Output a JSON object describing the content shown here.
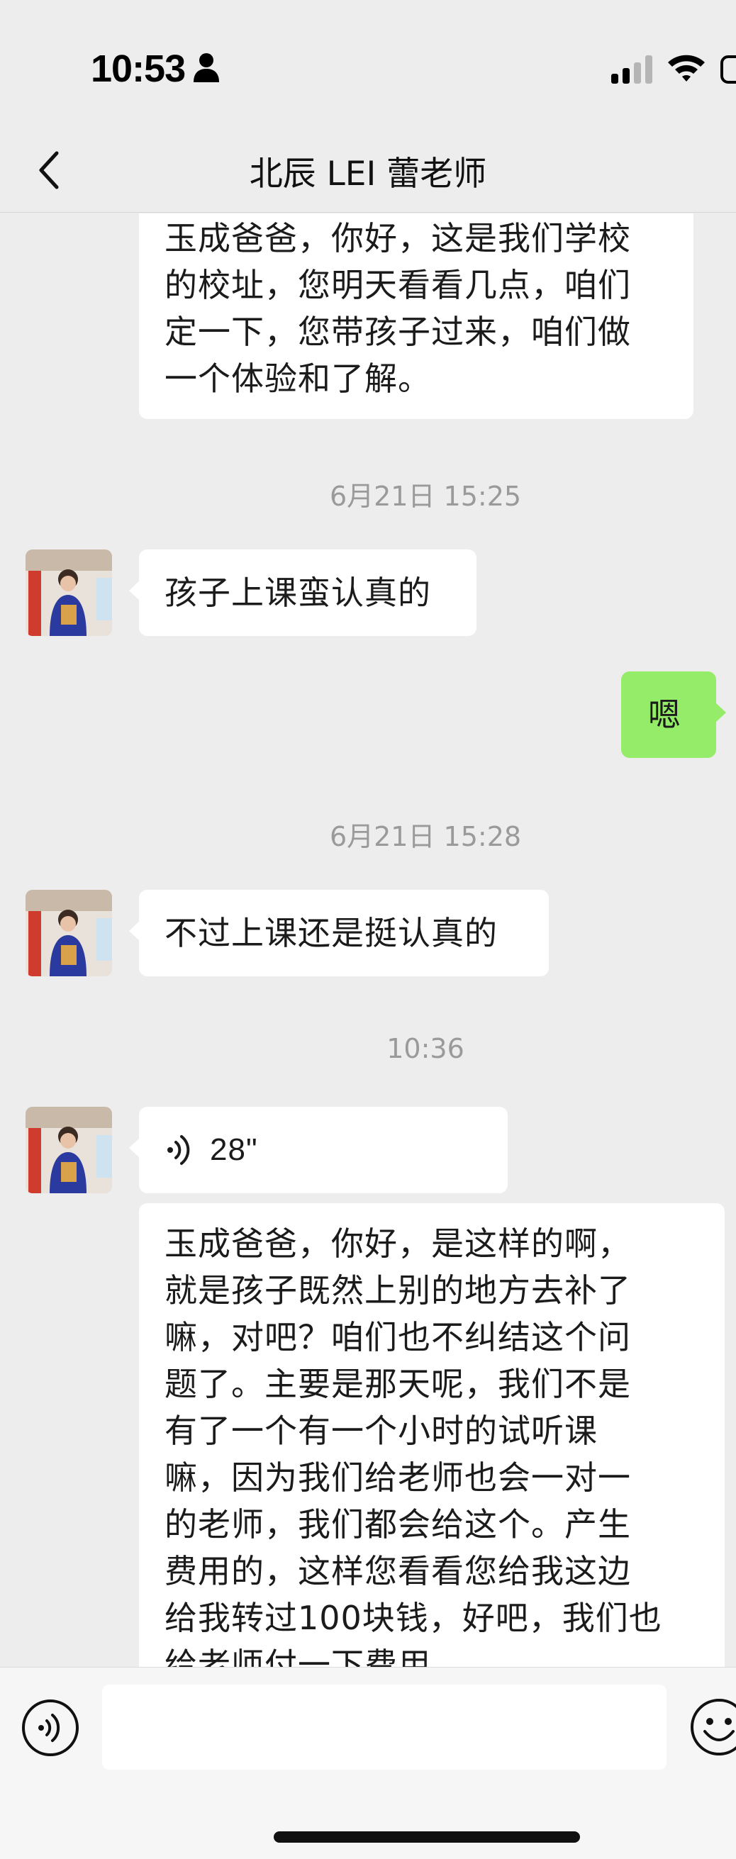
{
  "status_bar": {
    "time": "10:53"
  },
  "header": {
    "title": "北辰 LEI 蕾老师"
  },
  "messages": [
    {
      "side": "left",
      "type": "text",
      "lines": [
        "玉成爸爸，你好，这是我们学校",
        "的校址，您明天看看几点，咱们",
        "定一下，您带孩子过来，咱们做",
        "一个体验和了解。"
      ]
    },
    {
      "type": "timestamp",
      "text": "6月21日 15:25"
    },
    {
      "side": "left",
      "type": "text",
      "lines": [
        "孩子上课蛮认真的"
      ]
    },
    {
      "side": "right",
      "type": "text",
      "lines": [
        "嗯"
      ]
    },
    {
      "type": "timestamp",
      "text": "6月21日 15:28"
    },
    {
      "side": "left",
      "type": "text",
      "lines": [
        "不过上课还是挺认真的"
      ]
    },
    {
      "type": "timestamp",
      "text": "10:36"
    },
    {
      "side": "left",
      "type": "voice",
      "duration": "28\""
    },
    {
      "side": "left",
      "type": "text",
      "lines": [
        "玉成爸爸，你好，是这样的啊，",
        "就是孩子既然上别的地方去补了",
        "嘛，对吧？咱们也不纠结这个问",
        "题了。主要是那天呢，我们不是",
        "有了一个有一个小时的试听课",
        "嘛，因为我们给老师也会一对一",
        "的老师，我们都会给这个。产生",
        "费用的，这样您看看您给我这边",
        "给我转过100块钱，好吧，我们也",
        "给老师付一下费用。"
      ]
    }
  ],
  "input": {
    "value": "",
    "placeholder": ""
  },
  "icons": {
    "back": "chevron-left-icon",
    "voice": "voice-mode-icon",
    "emoji": "emoji-icon"
  },
  "colors": {
    "background": "#ededed",
    "my_bubble": "#95ec69",
    "their_bubble": "#ffffff",
    "timestamp": "#9a9a9a"
  }
}
